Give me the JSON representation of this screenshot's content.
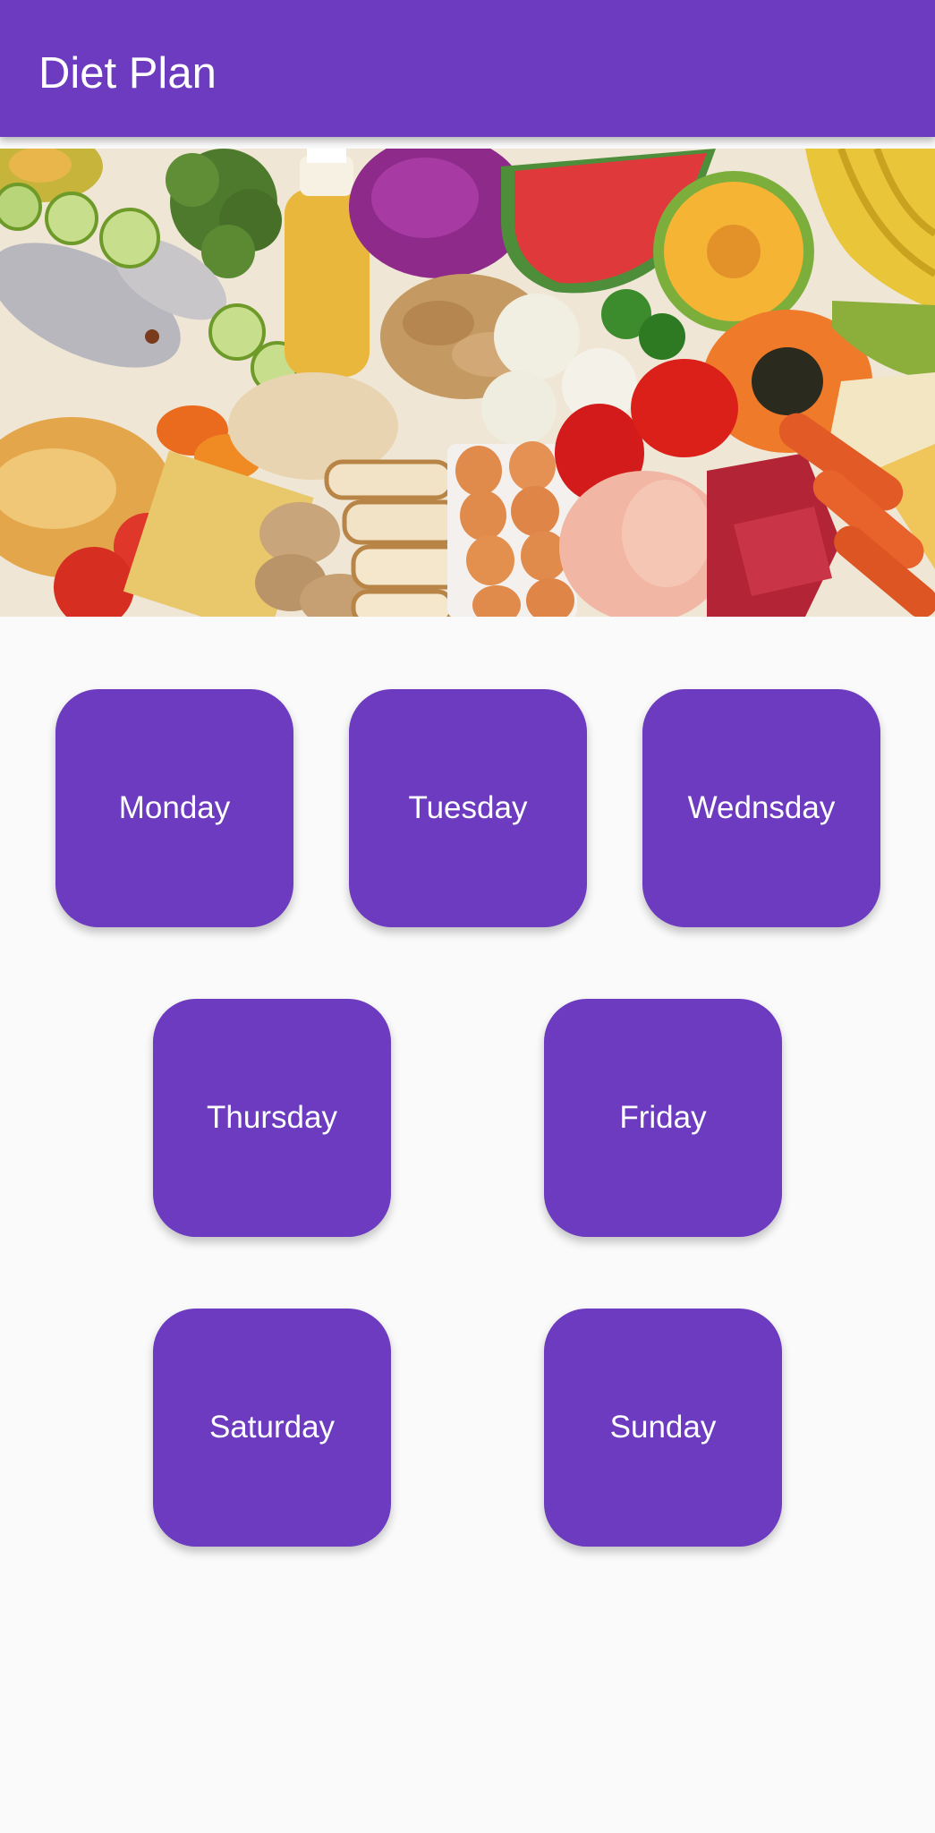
{
  "appbar": {
    "title": "Diet Plan",
    "color": "#6c3bbf"
  },
  "banner": {
    "icon": "food-groceries-photo"
  },
  "days": {
    "monday": "Monday",
    "tuesday": "Tuesday",
    "wednesday": "Wednsday",
    "thursday": "Thursday",
    "friday": "Friday",
    "saturday": "Saturday",
    "sunday": "Sunday"
  },
  "colors": {
    "accent": "#6c3bbf",
    "background": "#fafafa",
    "button_text": "#ffffff"
  }
}
